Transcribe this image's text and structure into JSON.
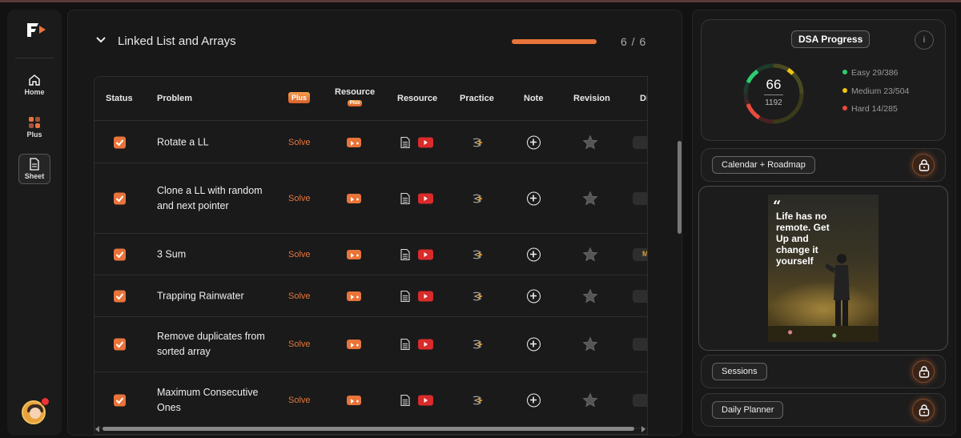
{
  "sidebar": {
    "logo": "F",
    "items": [
      {
        "label": "Home",
        "icon": "home-icon"
      },
      {
        "label": "Plus",
        "icon": "grid-icon"
      },
      {
        "label": "Sheet",
        "icon": "document-icon",
        "active": true
      }
    ]
  },
  "section": {
    "title": "Linked List and Arrays",
    "progress": 1.0,
    "count": "6 / 6"
  },
  "table": {
    "headers": {
      "status": "Status",
      "problem": "Problem",
      "plus": "Plus",
      "resource_plus": "Resource",
      "resource_plus_badge": "Plus",
      "resource": "Resource",
      "practice": "Practice",
      "note": "Note",
      "revision": "Revision",
      "difficulty": "Di"
    },
    "rows": [
      {
        "problem": "Rotate a LL",
        "solve": "Solve",
        "checked": true,
        "difficulty": ""
      },
      {
        "problem": "Clone a LL with random and next pointer",
        "solve": "Solve",
        "checked": true,
        "difficulty": ""
      },
      {
        "problem": "3 Sum",
        "solve": "Solve",
        "checked": true,
        "difficulty": "M"
      },
      {
        "problem": "Trapping Rainwater",
        "solve": "Solve",
        "checked": true,
        "difficulty": ""
      },
      {
        "problem": "Remove duplicates from sorted array",
        "solve": "Solve",
        "checked": true,
        "difficulty": ""
      },
      {
        "problem": "Maximum Consecutive Ones",
        "solve": "Solve",
        "checked": true,
        "difficulty": ""
      }
    ]
  },
  "progress": {
    "title": "DSA Progress",
    "info": "i",
    "solved": "66",
    "total": "1192",
    "legend": [
      {
        "label": "Easy 29/386",
        "color": "#2ecc71"
      },
      {
        "label": "Medium 23/504",
        "color": "#f1c40f"
      },
      {
        "label": "Hard 14/285",
        "color": "#e74c3c"
      }
    ]
  },
  "cards": {
    "calendar": "Calendar + Roadmap",
    "sessions": "Sessions",
    "planner": "Daily Planner"
  },
  "poster": {
    "quote_mark": "“",
    "text": "Life has no remote. Get Up and change it yourself"
  },
  "colors": {
    "accent": "#e8743b",
    "background": "#121212",
    "panel": "#181818"
  }
}
